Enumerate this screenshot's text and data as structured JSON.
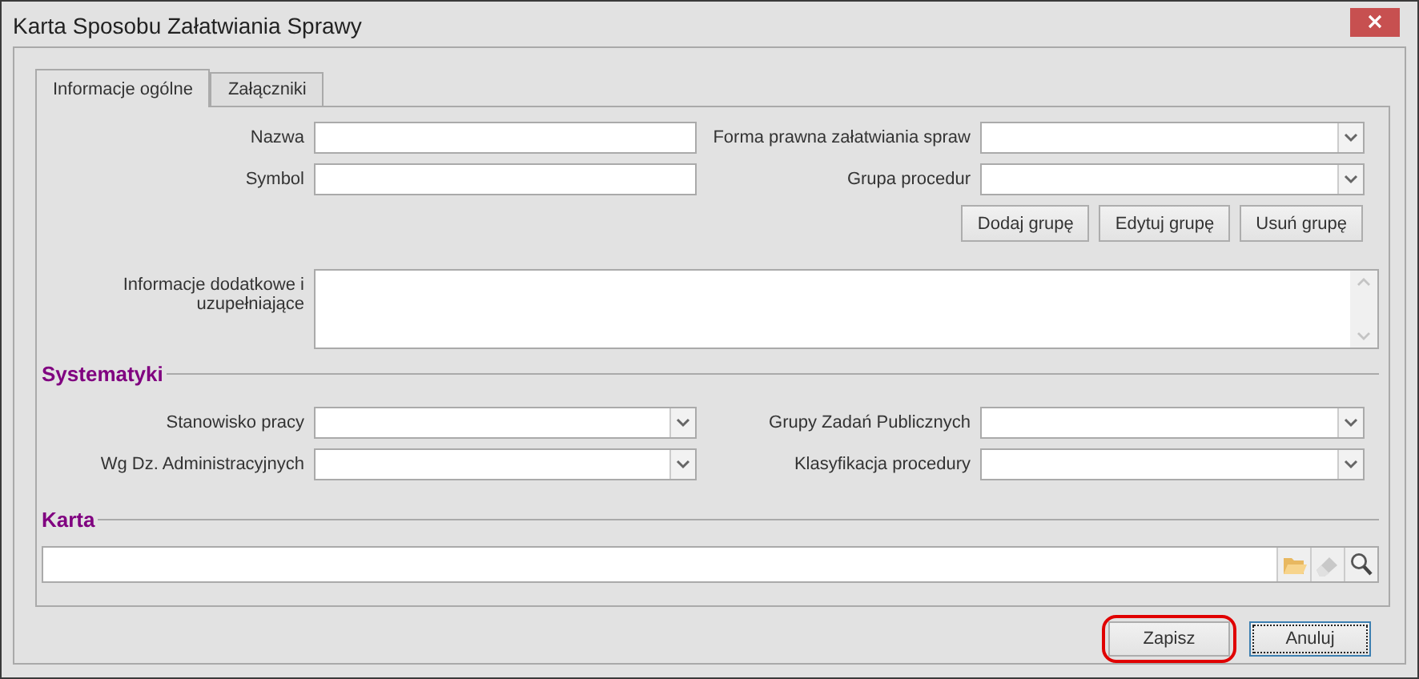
{
  "window": {
    "title": "Karta Sposobu Załatwiania Sprawy"
  },
  "tabs": [
    {
      "label": "Informacje ogólne",
      "selected": true
    },
    {
      "label": "Załączniki",
      "selected": false
    }
  ],
  "main_rows": [
    {
      "left": {
        "label": "Nazwa",
        "kind": "text"
      },
      "right": {
        "label": "Forma prawna załatwiania spraw",
        "kind": "combo"
      }
    },
    {
      "left": {
        "label": "Symbol",
        "kind": "text"
      },
      "right": {
        "label": "Grupa procedur",
        "kind": "combo"
      }
    }
  ],
  "group_buttons": [
    "Dodaj grupę",
    "Edytuj grupę",
    "Usuń grupę"
  ],
  "notes": {
    "label": "Informacje dodatkowe i uzupełniające"
  },
  "systematics": {
    "title": "Systematyki",
    "rows": [
      {
        "left": {
          "label": "Stanowisko pracy",
          "kind": "combo"
        },
        "right": {
          "label": "Grupy Zadań Publicznych",
          "kind": "combo"
        }
      },
      {
        "left": {
          "label": "Wg Dz. Administracyjnych",
          "kind": "combo"
        },
        "right": {
          "label": "Klasyfikacja procedury",
          "kind": "combo"
        }
      }
    ]
  },
  "card": {
    "title": "Karta",
    "tools": [
      {
        "kind": "folder",
        "disabled": false
      },
      {
        "kind": "eraser",
        "disabled": true
      },
      {
        "kind": "search",
        "disabled": false
      }
    ]
  },
  "buttons": [
    {
      "label": "Zapisz",
      "highlighted": true,
      "focused": false
    },
    {
      "label": "Anuluj",
      "highlighted": false,
      "focused": true
    }
  ]
}
